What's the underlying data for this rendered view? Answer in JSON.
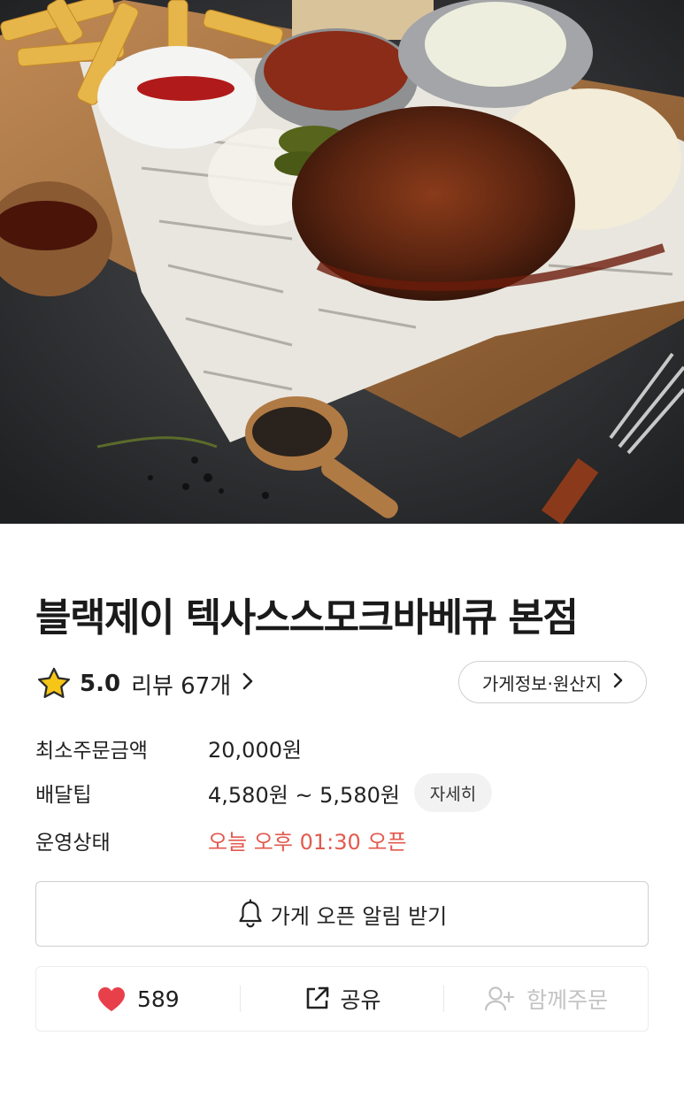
{
  "hero": {
    "icon": "food-photo"
  },
  "store": {
    "name": "블랙제이 텍사스스모크바베큐 본점",
    "rating": "5.0",
    "reviews_label": "리뷰 67개",
    "info_button": "가게정보·원산지"
  },
  "details": {
    "min_order_label": "최소주문금액",
    "min_order_value": "20,000원",
    "delivery_tip_label": "배달팁",
    "delivery_tip_value": "4,580원 ~ 5,580원",
    "delivery_tip_detail": "자세히",
    "status_label": "운영상태",
    "status_value": "오늘 오후 01:30 오픈"
  },
  "notify": {
    "label": "가게 오픈 알림 받기"
  },
  "actions": {
    "like_count": "589",
    "share_label": "공유",
    "group_order_label": "함께주문"
  },
  "colors": {
    "accent_red": "#e25a4f",
    "heart": "#e8404b",
    "star": "#f5c518"
  }
}
